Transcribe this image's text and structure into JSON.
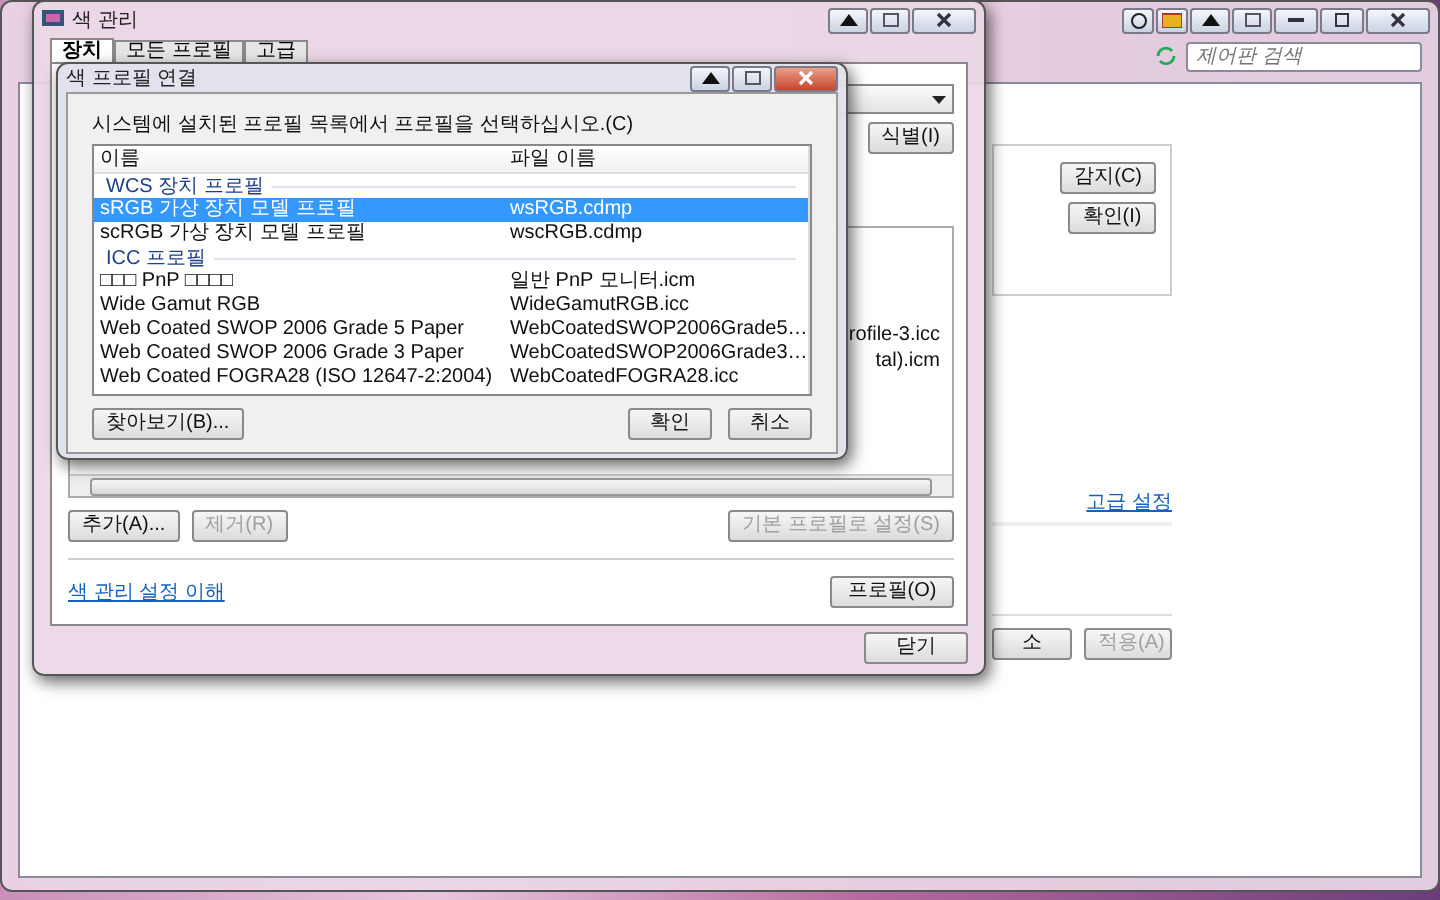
{
  "control_panel": {
    "search": {
      "placeholder": "제어판 검색"
    },
    "detect_buttons": [
      {
        "label": "감지(C)",
        "disabled": false
      },
      {
        "label": "확인(I)",
        "disabled": false
      }
    ],
    "link": "고급 설정",
    "footer_buttons": [
      {
        "label": "소",
        "disabled": false
      },
      {
        "label": "적용(A)",
        "disabled": true
      }
    ]
  },
  "color_management": {
    "title": "색 관리",
    "tabs": [
      {
        "label": "장치",
        "selected": true
      },
      {
        "label": "모든 프로필",
        "selected": false
      },
      {
        "label": "고급",
        "selected": false
      }
    ],
    "identify_button": "식별(I)",
    "list_fragments": [
      "rofile-3.icc",
      "tal).icm"
    ],
    "list_buttons": [
      {
        "label": "추가(A)...",
        "disabled": false
      },
      {
        "label": "제거(R)",
        "disabled": true
      },
      {
        "label": "기본 프로필로 설정(S)",
        "disabled": true
      }
    ],
    "link": "색 관리 설정 이해",
    "profile_button": "프로필(O)",
    "close_button": "닫기"
  },
  "dialog": {
    "title": "색 프로필 연결",
    "instruction": "시스템에 설치된 프로필 목록에서 프로필을 선택하십시오.(C)",
    "columns": [
      "이름",
      "파일 이름"
    ],
    "groups": [
      {
        "name": "WCS 장치 프로필",
        "rows": [
          {
            "name": "sRGB 가상 장치 모델 프로필",
            "file": "wsRGB.cdmp",
            "selected": true
          },
          {
            "name": "scRGB 가상 장치 모델 프로필",
            "file": "wscRGB.cdmp",
            "selected": false
          }
        ]
      },
      {
        "name": "ICC 프로필",
        "rows": [
          {
            "name": "□□□ PnP □□□□",
            "file": "일반 PnP 모니터.icm",
            "selected": false
          },
          {
            "name": "Wide Gamut RGB",
            "file": "WideGamutRGB.icc",
            "selected": false
          },
          {
            "name": "Web Coated SWOP 2006 Grade 5 Paper",
            "file": "WebCoatedSWOP2006Grade5…",
            "selected": false
          },
          {
            "name": "Web Coated SWOP 2006 Grade 3 Paper",
            "file": "WebCoatedSWOP2006Grade3…",
            "selected": false
          },
          {
            "name": "Web Coated FOGRA28 (ISO 12647-2:2004)",
            "file": "WebCoatedFOGRA28.icc",
            "selected": false
          }
        ]
      }
    ],
    "browse_button": "찾아보기(B)...",
    "ok_button": "확인",
    "cancel_button": "취소"
  }
}
